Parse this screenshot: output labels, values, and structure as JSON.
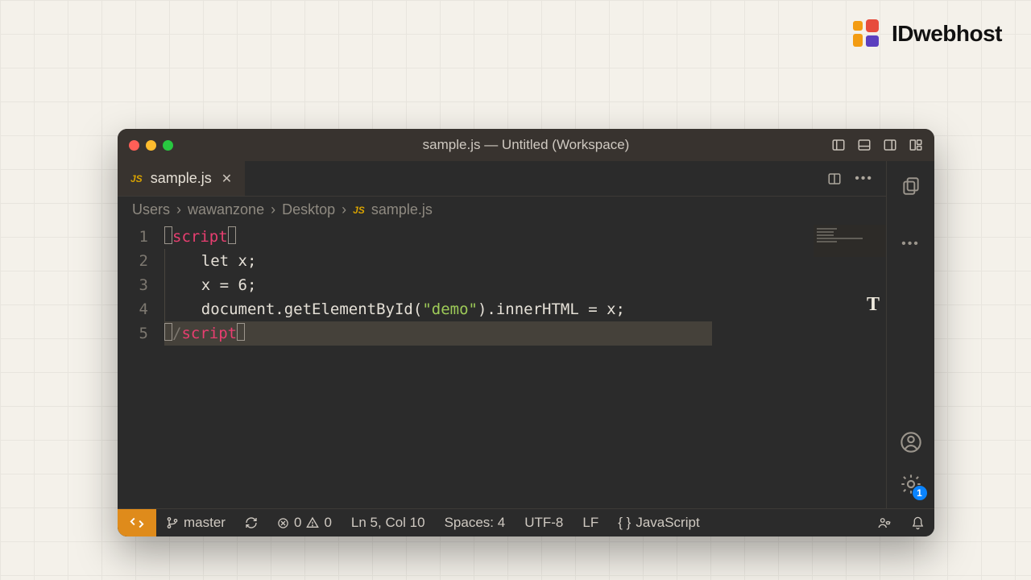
{
  "brand": {
    "name": "IDwebhost"
  },
  "window": {
    "title": "sample.js — Untitled (Workspace)"
  },
  "tab": {
    "icon": "JS",
    "filename": "sample.js"
  },
  "breadcrumb": {
    "parts": [
      "Users",
      "wawanzone",
      "Desktop"
    ],
    "file_icon": "JS",
    "file": "sample.js"
  },
  "code": {
    "lines": [
      "1",
      "2",
      "3",
      "4",
      "5"
    ],
    "l1": {
      "open": "<",
      "tag": "script",
      "close": ">"
    },
    "l2": {
      "kw": "let",
      "rest": " x;"
    },
    "l3": {
      "text": "x = 6;"
    },
    "l4": {
      "a": "document.getElementById(",
      "str": "\"demo\"",
      "b": ").innerHTML = x;"
    },
    "l5": {
      "open": "</",
      "tag": "script",
      "close": ">"
    }
  },
  "settings_badge": "1",
  "status": {
    "branch": "master",
    "errors": "0",
    "warnings": "0",
    "cursor": "Ln 5, Col 10",
    "spaces": "Spaces: 4",
    "encoding": "UTF-8",
    "eol": "LF",
    "language": "JavaScript"
  }
}
